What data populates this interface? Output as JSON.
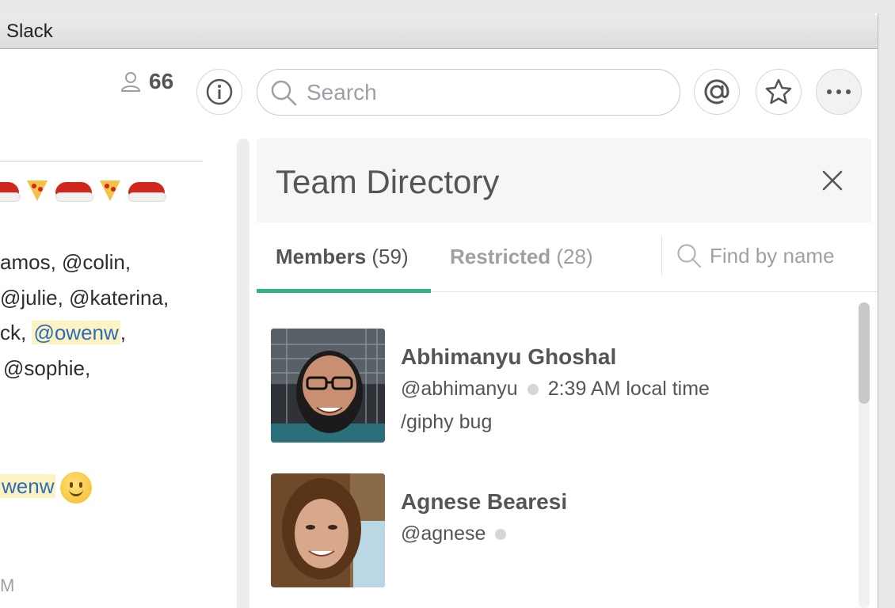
{
  "window": {
    "title": "Slack"
  },
  "header": {
    "member_count": "66",
    "search_placeholder": "Search"
  },
  "messages": {
    "line1": "amos, @colin,",
    "line2": "@julie, @katerina,",
    "line3_prefix": "ck, ",
    "line3_mention": "@owenw",
    "line3_suffix": ",",
    "line4": "@sophie,",
    "line5_mention": "wenw",
    "time_fragment": "M"
  },
  "directory": {
    "title": "Team Directory",
    "tabs": [
      {
        "label": "Members",
        "count": "(59)"
      },
      {
        "label": "Restricted",
        "count": "(28)"
      }
    ],
    "find_placeholder": "Find by name",
    "members": [
      {
        "name": "Abhimanyu Ghoshal",
        "handle": "@abhimanyu",
        "local_time": "2:39 AM local time",
        "status": "/giphy bug"
      },
      {
        "name": "Agnese Bearesi",
        "handle": "@agnese"
      }
    ]
  },
  "colors": {
    "accent": "#2eb67d",
    "mention_bg": "#fcf2c2",
    "mention_text": "#2a6ebb"
  },
  "icons": [
    "person-icon",
    "info-icon",
    "search-icon",
    "at-sign-icon",
    "star-icon",
    "more-icon",
    "close-icon"
  ]
}
